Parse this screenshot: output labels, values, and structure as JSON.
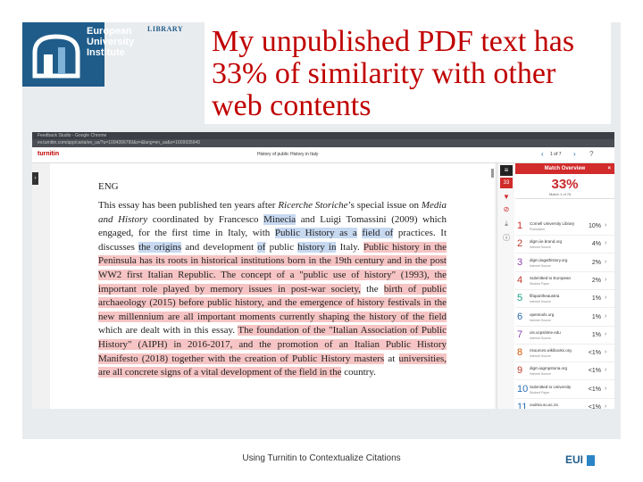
{
  "logo": {
    "lines": [
      "European",
      "University",
      "Institute"
    ],
    "library": "LIBRARY"
  },
  "slide_title": "My unpublished PDF text has 33% of similarity with other web contents",
  "browser": {
    "window_title": "Feedback Studio - Google Chrome",
    "url": "ev.turnitin.com/app/carta/en_us/?u=1094396799&s=&lang=en_us&o=1609935940",
    "app_name": "turnitin",
    "document_title": "History of public History in Italy",
    "page_indicator": "1 of 7",
    "nav_prev": "‹",
    "nav_next": "›",
    "help_icon": "?"
  },
  "document": {
    "heading": "ENG",
    "segments": [
      {
        "t": "This essay has been published ten years after ",
        "c": ""
      },
      {
        "t": "Ricerche Storiche",
        "c": "i"
      },
      {
        "t": "’s special issue on ",
        "c": ""
      },
      {
        "t": "Media and History",
        "c": "i"
      },
      {
        "t": " coordinated by Francesco ",
        "c": ""
      },
      {
        "t": "Minecia",
        "c": "b"
      },
      {
        "t": " and Luigi Tomassini (2009) which engaged, for the first time in Italy, with ",
        "c": ""
      },
      {
        "t": "Public History as a",
        "c": "b"
      },
      {
        "t": " ",
        "c": ""
      },
      {
        "t": "field of",
        "c": "b"
      },
      {
        "t": " practices. It discusses ",
        "c": ""
      },
      {
        "t": "the origins",
        "c": "b"
      },
      {
        "t": " and development ",
        "c": ""
      },
      {
        "t": "of",
        "c": "b"
      },
      {
        "t": " public ",
        "c": ""
      },
      {
        "t": "history in",
        "c": "b"
      },
      {
        "t": " Italy. ",
        "c": ""
      },
      {
        "t": "Public history in the Peninsula has its roots in historical institutions born in the 19th century and in the post WW2 first Italian Republic. The concept of a \"public use of history\" (1993), the important role played by memory issues in post-war society,",
        "c": "r"
      },
      {
        "t": " the ",
        "c": ""
      },
      {
        "t": "birth of public archaeology (2015) before public history, and the emergence of history festivals in the new millennium are all important moments currently shaping the history of the field",
        "c": "r"
      },
      {
        "t": " which are dealt with in this essay. ",
        "c": ""
      },
      {
        "t": "The foundation of the \"Italian Association of Public History\" (AIPH) in 2016-2017, and the promotion of an Italian Public History Manifesto (2018) together with the creation of Public History masters",
        "c": "r"
      },
      {
        "t": " at ",
        "c": ""
      },
      {
        "t": "universities, are all concrete signs of a vital development of the field in the",
        "c": "r"
      },
      {
        "t": " country.",
        "c": ""
      }
    ]
  },
  "toolbar": {
    "buttons": [
      "layers",
      "33",
      "filter",
      "download",
      "info"
    ]
  },
  "match_overview": {
    "title": "Match Overview",
    "close": "×",
    "percentage": "33%",
    "sub": "Match 1 of 76",
    "matches": [
      {
        "num": "1",
        "source": "Cornell University Library",
        "type": "Publication",
        "pct": "10%",
        "color": "#d02b2b"
      },
      {
        "num": "2",
        "source": "digm.iie.brand.org",
        "type": "Internet Source",
        "pct": "4%",
        "color": "#c0392b"
      },
      {
        "num": "3",
        "source": "digm.iiagathistory.org",
        "type": "Internet Source",
        "pct": "2%",
        "color": "#8e44ad"
      },
      {
        "num": "4",
        "source": "Submitted to European",
        "type": "Student Paper",
        "pct": "2%",
        "color": "#c0392b"
      },
      {
        "num": "5",
        "source": "fifaparitheaustria",
        "type": "Internet Source",
        "pct": "1%",
        "color": "#16a085"
      },
      {
        "num": "6",
        "source": "opentools.org",
        "type": "Internet Source",
        "pct": "1%",
        "color": "#2c6fb0"
      },
      {
        "num": "7",
        "source": "ois.ucpsitime.edu",
        "type": "Internet Source",
        "pct": "1%",
        "color": "#8e44ad"
      },
      {
        "num": "8",
        "source": "risources.wikibooks.org",
        "type": "Internet Source",
        "pct": "<1%",
        "color": "#d35400"
      },
      {
        "num": "9",
        "source": "digm.iagmpstoria.org",
        "type": "Internet Source",
        "pct": "<1%",
        "color": "#c0392b"
      },
      {
        "num": "10",
        "source": "Submitted to University",
        "type": "Student Paper",
        "pct": "<1%",
        "color": "#2c6fb0"
      },
      {
        "num": "11",
        "source": "oodma.su.ac.za",
        "type": "Internet Source",
        "pct": "<1%",
        "color": "#2c6fb0"
      }
    ]
  },
  "footer": "Using Turnitin to Contextualize Citations",
  "eui": "EUI"
}
